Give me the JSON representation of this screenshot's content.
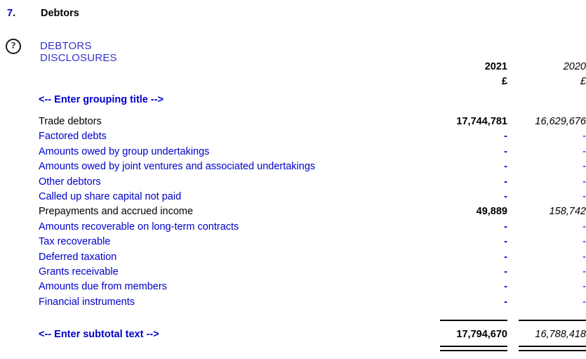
{
  "section": {
    "number": "7",
    "number_dot": ".",
    "title": "Debtors"
  },
  "help": {
    "icon": "question-mark-circle-icon",
    "icon_glyph": "?",
    "label": "DEBTORS DISCLOSURES"
  },
  "columns": {
    "current": {
      "year": "2021",
      "unit": "£"
    },
    "prior": {
      "year": "2020",
      "unit": "£"
    }
  },
  "grouping_title": "<-- Enter grouping title -->",
  "rows": [
    {
      "label": "Trade debtors",
      "v2021": "17,744,781",
      "v2020": "16,629,676",
      "editable": false
    },
    {
      "label": "Factored debts",
      "v2021": "-",
      "v2020": "-",
      "editable": true
    },
    {
      "label": "Amounts owed by group undertakings",
      "v2021": "-",
      "v2020": "-",
      "editable": true
    },
    {
      "label": "Amounts owed by joint ventures and associated undertakings",
      "v2021": "-",
      "v2020": "-",
      "editable": true
    },
    {
      "label": "Other debtors",
      "v2021": "-",
      "v2020": "-",
      "editable": true
    },
    {
      "label": "Called up share capital not paid",
      "v2021": "-",
      "v2020": "-",
      "editable": true
    },
    {
      "label": "Prepayments and accrued income",
      "v2021": "49,889",
      "v2020": "158,742",
      "editable": false
    },
    {
      "label": "Amounts recoverable on long-term contracts",
      "v2021": "-",
      "v2020": "-",
      "editable": true
    },
    {
      "label": "Tax recoverable",
      "v2021": "-",
      "v2020": "-",
      "editable": true
    },
    {
      "label": "Deferred taxation",
      "v2021": "-",
      "v2020": "-",
      "editable": true
    },
    {
      "label": "Grants receivable",
      "v2021": "-",
      "v2020": "-",
      "editable": true
    },
    {
      "label": "Amounts due from members",
      "v2021": "-",
      "v2020": "-",
      "editable": true
    },
    {
      "label": "Financial instruments",
      "v2021": "-",
      "v2020": "-",
      "editable": true
    }
  ],
  "subtotal": {
    "label": "<-- Enter subtotal text -->",
    "v2021": "17,794,670",
    "v2020": "16,788,418"
  },
  "colors": {
    "editable_blue": "#0000cc",
    "heading_blue": "#3333cc",
    "text_black": "#000000",
    "rule_black": "#000000"
  }
}
